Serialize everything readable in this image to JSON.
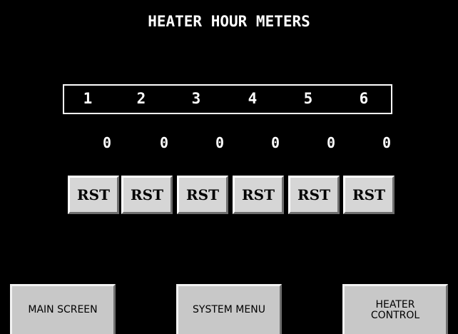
{
  "screen": {
    "title": "HEATER HOUR METERS",
    "background_color": "#000000",
    "text_color": "#ffffff",
    "button_color": "#d6d6d6"
  },
  "heaters": [
    {
      "number": "1",
      "hours": "0",
      "reset_label": "RST"
    },
    {
      "number": "2",
      "hours": "0",
      "reset_label": "RST"
    },
    {
      "number": "3",
      "hours": "0",
      "reset_label": "RST"
    },
    {
      "number": "4",
      "hours": "0",
      "reset_label": "RST"
    },
    {
      "number": "5",
      "hours": "0",
      "reset_label": "RST"
    },
    {
      "number": "6",
      "hours": "0",
      "reset_label": "RST"
    }
  ],
  "nav": {
    "main_screen": "MAIN SCREEN",
    "system_menu": "SYSTEM MENU",
    "heater_control_line1": "HEATER",
    "heater_control_line2": "CONTROL"
  }
}
